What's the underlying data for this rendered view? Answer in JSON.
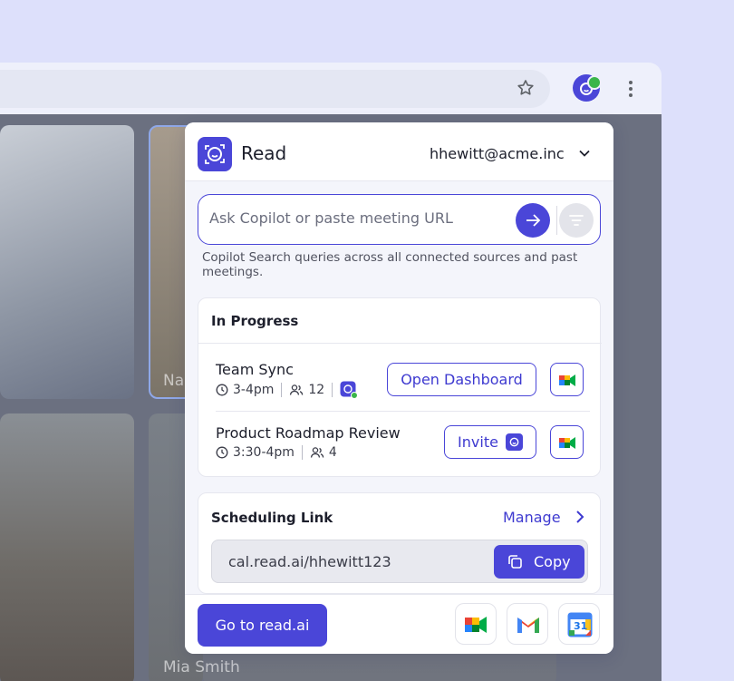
{
  "browser": {
    "tile_labels": [
      "Na",
      "Mia Smith"
    ]
  },
  "popup": {
    "app_name": "Read",
    "account_email": "hhewitt@acme.inc",
    "search": {
      "placeholder": "Ask Copilot or paste meeting URL"
    },
    "search_hint": "Copilot Search queries across all connected sources and past meetings.",
    "in_progress": {
      "title": "In Progress",
      "meetings": [
        {
          "title": "Team Sync",
          "time": "3-4pm",
          "participants": "12",
          "action_label": "Open Dashboard"
        },
        {
          "title": "Product Roadmap Review",
          "time": "3:30-4pm",
          "participants": "4",
          "action_label": "Invite"
        }
      ]
    },
    "scheduling": {
      "title": "Scheduling Link",
      "manage_label": "Manage",
      "link": "cal.read.ai/hhewitt123",
      "copy_label": "Copy"
    },
    "footer": {
      "go_label": "Go to read.ai",
      "apps": [
        "google-meet-icon",
        "gmail-icon",
        "google-calendar-icon"
      ],
      "calendar_day": "31"
    }
  },
  "colors": {
    "accent": "#4a46d8",
    "background": "#dde0fb",
    "badge_green": "#3ab54a"
  }
}
